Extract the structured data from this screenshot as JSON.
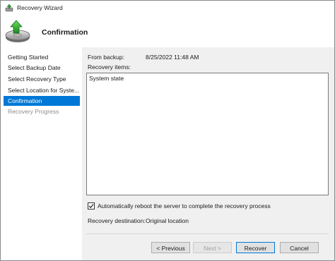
{
  "window": {
    "title": "Recovery Wizard",
    "title_icon": "recovery-wizard-icon"
  },
  "header": {
    "title": "Confirmation",
    "icon": "backup-restore-icon"
  },
  "sidebar": {
    "items": [
      {
        "label": "Getting Started",
        "state": "normal"
      },
      {
        "label": "Select Backup Date",
        "state": "normal"
      },
      {
        "label": "Select Recovery Type",
        "state": "normal"
      },
      {
        "label": "Select Location for Syste...",
        "state": "normal"
      },
      {
        "label": "Confirmation",
        "state": "active"
      },
      {
        "label": "Recovery Progress",
        "state": "disabled"
      }
    ]
  },
  "details": {
    "from_backup_label": "From backup:",
    "from_backup_value": "8/25/2022 11:48 AM",
    "recovery_items_label": "Recovery items:",
    "recovery_items": [
      "System state"
    ],
    "auto_reboot_label": "Automatically reboot the server to complete the recovery process",
    "auto_reboot_checked": true,
    "destination_label": "Recovery destination:",
    "destination_value": "Original location"
  },
  "buttons": {
    "previous": "< Previous",
    "next": "Next >",
    "recover": "Recover",
    "cancel": "Cancel"
  },
  "colors": {
    "accent": "#0078d7",
    "panel_bg": "#f0f0f0",
    "disabled_text": "#8c8c8c"
  }
}
